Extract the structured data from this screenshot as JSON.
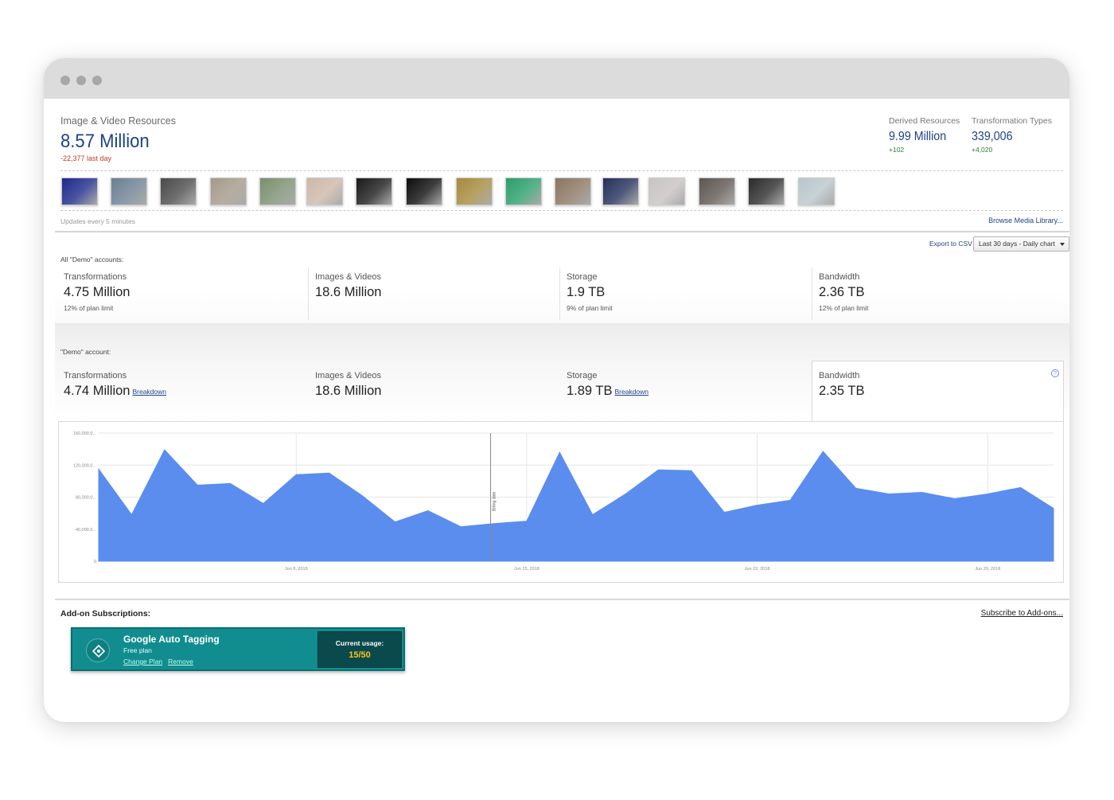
{
  "resources": {
    "title": "Image & Video Resources",
    "value": "8.57 Million",
    "delta": "-22,377 last day"
  },
  "derived": {
    "label": "Derived Resources",
    "value": "9.99 Million",
    "delta": "+102"
  },
  "transformation_types": {
    "label": "Transformation Types",
    "value": "339,006",
    "delta": "+4,020"
  },
  "thumbnails": [
    "#1e2a8a",
    "#6b7f91",
    "#4a4a4a",
    "#a4998a",
    "#7a8f6e",
    "#cdb8a8",
    "#1a1a1a",
    "#0d0d0d",
    "#a58a3c",
    "#2a9e6a",
    "#8a7560",
    "#24305a",
    "#c9c3c2",
    "#5d5550",
    "#2b2b2b",
    "#b9c6cc"
  ],
  "updates_text": "Updates every 5 minutes",
  "browse_link": "Browse Media Library...",
  "export_link": "Export to CSV",
  "range_select": "Last 30 days - Daily chart",
  "all_accounts": {
    "label": "All \"Demo\" accounts:",
    "transformations": {
      "label": "Transformations",
      "value": "4.75 Million",
      "sub": "12% of plan limit"
    },
    "images": {
      "label": "Images & Videos",
      "value": "18.6 Million"
    },
    "storage": {
      "label": "Storage",
      "value": "1.9 TB",
      "sub": "9% of plan limit"
    },
    "bandwidth": {
      "label": "Bandwidth",
      "value": "2.36 TB",
      "sub": "12% of plan limit"
    }
  },
  "demo_account": {
    "label": "\"Demo\" account:",
    "transformations": {
      "label": "Transformations",
      "value": "4.74 Million",
      "link": "Breakdown"
    },
    "images": {
      "label": "Images & Videos",
      "value": "18.6 Million"
    },
    "storage": {
      "label": "Storage",
      "value": "1.89 TB",
      "link": "Breakdown"
    },
    "bandwidth": {
      "label": "Bandwidth",
      "value": "2.35 TB"
    },
    "help": "?"
  },
  "chart_data": {
    "type": "area",
    "color": "#5b8def",
    "y_ticks": [
      "0",
      "40,000,0...",
      "80,000,0...",
      "120,000,0...",
      "160,000,0..."
    ],
    "ylim": [
      0,
      160000000
    ],
    "x_ticks": [
      "Jun 8, 2018",
      "Jun 15, 2018",
      "Jun 22, 2018",
      "Jun 29, 2018"
    ],
    "x_tick_index": [
      6,
      13,
      20,
      27
    ],
    "billing_label": "Billing date",
    "billing_index": 12,
    "values": [
      115000000,
      58000000,
      139000000,
      95000000,
      97000000,
      72000000,
      108000000,
      110000000,
      82000000,
      49000000,
      63000000,
      43000000,
      47000000,
      50000000,
      136000000,
      58000000,
      84000000,
      114000000,
      113000000,
      61000000,
      70000000,
      76000000,
      137000000,
      91000000,
      84000000,
      86000000,
      78000000,
      84000000,
      92000000,
      66000000
    ]
  },
  "addons": {
    "title": "Add-on Subscriptions:",
    "subscribe_link": "Subscribe to Add-ons...",
    "card": {
      "name": "Google Auto Tagging",
      "plan": "Free plan",
      "change": "Change Plan",
      "remove": "Remove",
      "usage_label": "Current usage:",
      "usage_value": "15/50"
    }
  }
}
